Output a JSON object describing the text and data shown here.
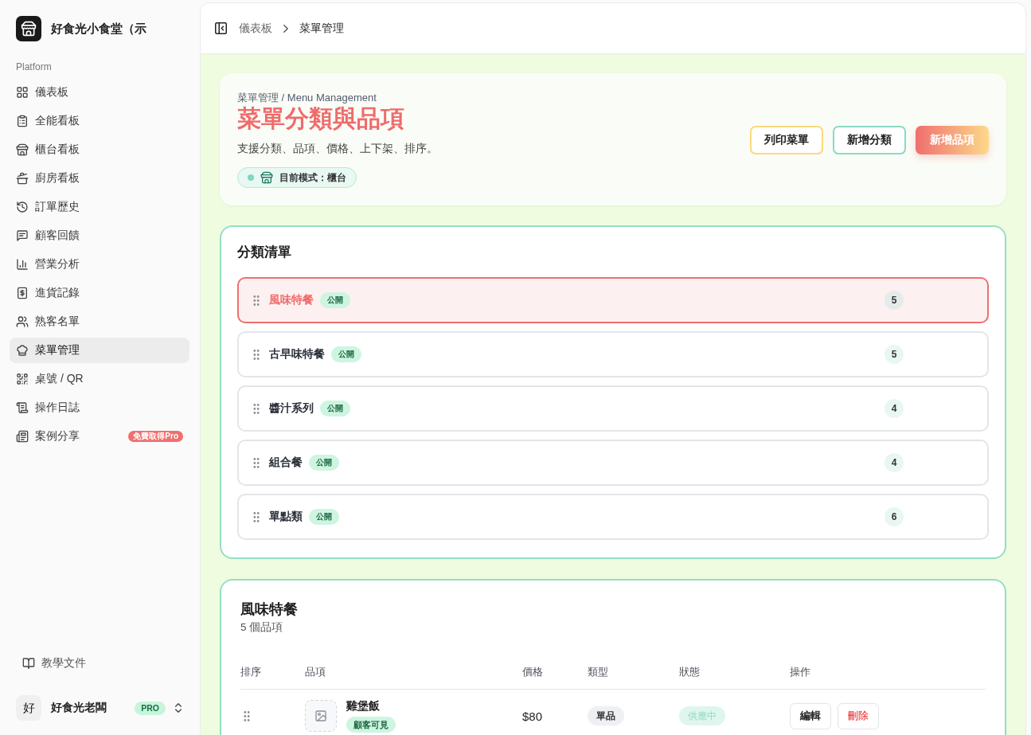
{
  "sidebar": {
    "brand": "好食光小食堂（示",
    "section_label": "Platform",
    "items": [
      {
        "label": "儀表板",
        "selected": false
      },
      {
        "label": "全能看板",
        "selected": false
      },
      {
        "label": "櫃台看板",
        "selected": false
      },
      {
        "label": "廚房看板",
        "selected": false
      },
      {
        "label": "訂單歷史",
        "selected": false
      },
      {
        "label": "顧客回饋",
        "selected": false
      },
      {
        "label": "營業分析",
        "selected": false
      },
      {
        "label": "進貨記錄",
        "selected": false
      },
      {
        "label": "熟客名單",
        "selected": false
      },
      {
        "label": "菜單管理",
        "selected": true
      },
      {
        "label": "桌號 / QR",
        "selected": false
      },
      {
        "label": "操作日誌",
        "selected": false
      },
      {
        "label": "案例分享",
        "selected": false,
        "badge": "免費取得Pro"
      }
    ],
    "docs_link": "教學文件",
    "user": {
      "avatar": "好",
      "name": "好食光老闆",
      "plan": "PRO"
    }
  },
  "breadcrumb": [
    {
      "label": "儀表板",
      "current": false
    },
    {
      "label": "菜單管理",
      "current": true
    }
  ],
  "page_header": {
    "eyebrow": "菜單管理 / Menu Management",
    "title": "菜單分類與品項",
    "description": "支援分類、品項、價格、上下架、排序。",
    "mode": "目前模式：櫃台",
    "buttons": [
      {
        "label": "列印菜單",
        "kind": "print"
      },
      {
        "label": "新增分類",
        "kind": "secondary"
      },
      {
        "label": "新增品項",
        "kind": "primary"
      }
    ]
  },
  "categories": {
    "title": "分類清單",
    "items": [
      {
        "name": "風味特餐",
        "visibility": "公開",
        "count": "5",
        "selected": true
      },
      {
        "name": "古早味特餐",
        "visibility": "公開",
        "count": "5",
        "selected": false
      },
      {
        "name": "醬汁系列",
        "visibility": "公開",
        "count": "4",
        "selected": false
      },
      {
        "name": "組合餐",
        "visibility": "公開",
        "count": "4",
        "selected": false
      },
      {
        "name": "單點類",
        "visibility": "公開",
        "count": "6",
        "selected": false
      }
    ]
  },
  "items_panel": {
    "title": "風味特餐",
    "subtitle": "5 個品項",
    "table": {
      "columns": [
        "排序",
        "品項",
        "價格",
        "類型",
        "狀態",
        "操作"
      ],
      "rows": [
        {
          "name": "雞堡飯",
          "visibility": "顧客可見",
          "price": "$80",
          "type": "單品",
          "status": "供應中",
          "actions": [
            {
              "label": "編輯",
              "kind": "edit"
            },
            {
              "label": "刪除",
              "kind": "delete"
            }
          ]
        }
      ]
    }
  }
}
